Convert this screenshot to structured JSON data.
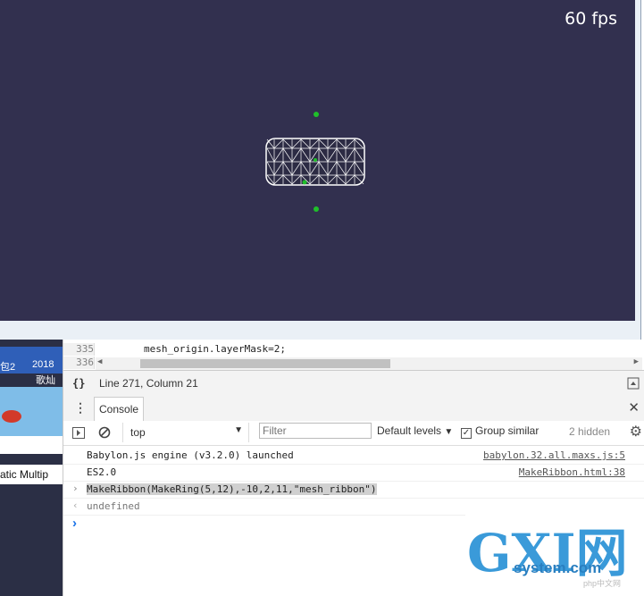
{
  "viewport": {
    "fps": "60 fps"
  },
  "desktop": {
    "thumb1_a": "包2",
    "thumb1_b": "2018",
    "thumb1_c": "歌灿",
    "thumb2": "atic Multip"
  },
  "editor": {
    "lines": [
      {
        "number": "335",
        "code": "mesh_origin.layerMask=2;"
      },
      {
        "number": "336",
        "code": ""
      }
    ]
  },
  "status": {
    "position": "Line 271, Column 21",
    "brace_icon": "{}"
  },
  "tabs": {
    "console": "Console"
  },
  "toolbar": {
    "context": "top",
    "filter_placeholder": "Filter",
    "levels": "Default levels",
    "group_similar": "Group similar",
    "hidden": "2 hidden"
  },
  "console": {
    "messages": [
      {
        "text": "Babylon.js engine (v3.2.0) launched",
        "source": "babylon.32.all.maxs.js:5"
      },
      {
        "text": "ES2.0",
        "source": "MakeRibbon.html:38"
      }
    ],
    "input": "MakeRibbon(MakeRing(5,12),-10,2,11,\"mesh_ribbon\")",
    "result": "undefined"
  },
  "watermark": {
    "big": "GXI网",
    "sub": "system.com",
    "small": "php中文网"
  },
  "colors": {
    "canvas": "#32304f",
    "accent": "#1a73e8"
  }
}
